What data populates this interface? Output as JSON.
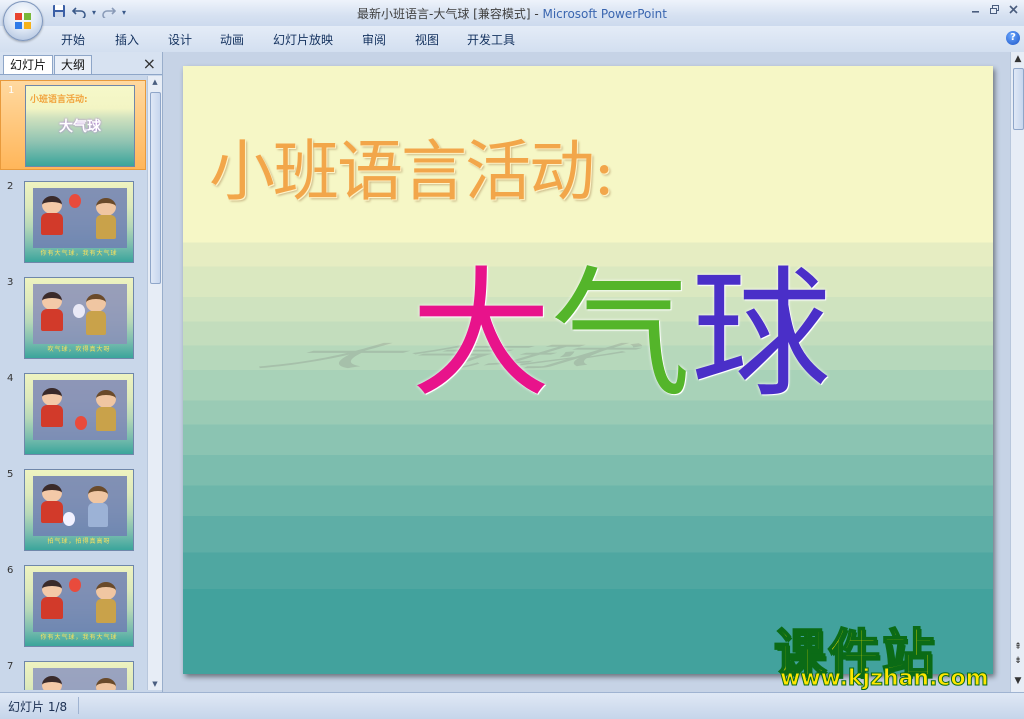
{
  "window": {
    "title": "最新小班语言-大气球 [兼容模式]",
    "separator": " - ",
    "app": "Microsoft PowerPoint"
  },
  "qat": {
    "save_icon": "save-icon",
    "undo_icon": "undo-icon",
    "redo_icon": "redo-icon"
  },
  "ribbon": {
    "tabs": [
      "开始",
      "插入",
      "设计",
      "动画",
      "幻灯片放映",
      "审阅",
      "视图",
      "开发工具"
    ]
  },
  "leftpane": {
    "tabs": [
      "幻灯片",
      "大纲"
    ],
    "close": "×"
  },
  "thumbnails": [
    {
      "num": "1",
      "title": "小班语言活动:",
      "subtitle": "大气球"
    },
    {
      "num": "2",
      "caption": "你有大气球，我有大气球"
    },
    {
      "num": "3",
      "caption": "吹气球，吹得真大呀"
    },
    {
      "num": "4",
      "caption": ""
    },
    {
      "num": "5",
      "caption": "拍气球，拍得真高呀"
    },
    {
      "num": "6",
      "caption": "你有大气球，我有大气球"
    },
    {
      "num": "7",
      "caption": ""
    }
  ],
  "slide": {
    "title": "小班语言活动:",
    "wordart": [
      "大",
      "气",
      "球"
    ]
  },
  "status": {
    "slide_indicator": "幻灯片 1/8"
  },
  "watermark": {
    "cn": "课件站",
    "url": "www.kjzhan.com"
  },
  "colors": {
    "title_orange": "#f2a64a",
    "wordart_magenta": "#e8138b",
    "wordart_green": "#54b52a",
    "wordart_violet": "#4a2fc8",
    "watermark_yellow": "#ffe600",
    "watermark_green": "#0b6b16"
  }
}
